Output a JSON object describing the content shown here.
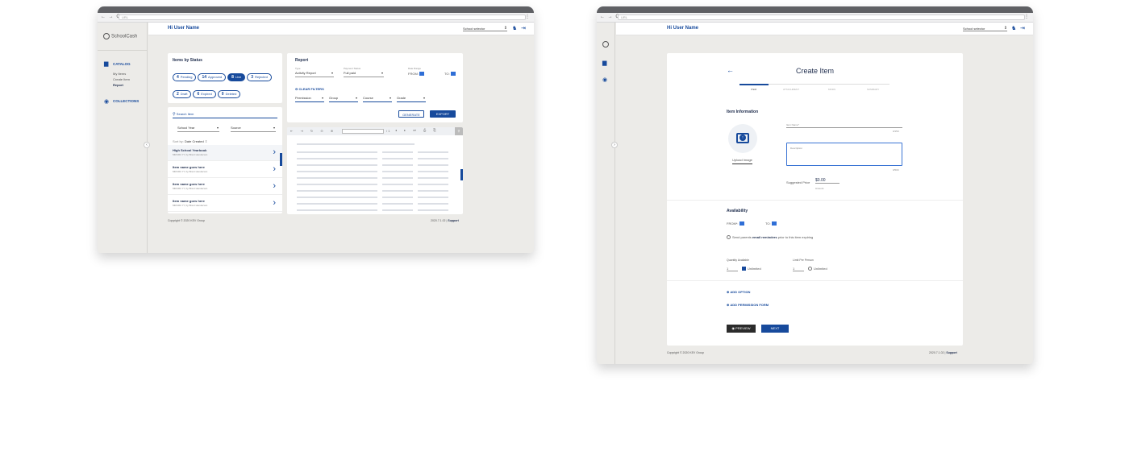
{
  "brand": {
    "name": "SchoolCash"
  },
  "browser": {
    "url": "URL"
  },
  "header": {
    "greeting": "Hi User Name",
    "school_select": "School selector"
  },
  "sidebar": {
    "catalog": "CATALOG",
    "sub": [
      "My Items",
      "Create Item",
      "Report"
    ],
    "collections": "COLLECTIONS"
  },
  "status": {
    "title": "Items by Status",
    "pills": [
      {
        "count": "4",
        "label": "Pending"
      },
      {
        "count": "14",
        "label": "Approved"
      },
      {
        "count": "8",
        "label": "Live"
      },
      {
        "count": "3",
        "label": "Rejected"
      },
      {
        "count": "2",
        "label": "Draft"
      },
      {
        "count": "6",
        "label": "Expired"
      },
      {
        "count": "0",
        "label": "Deleted"
      }
    ]
  },
  "search": {
    "placeholder": "Search Item",
    "school_year": "School Year",
    "source": "Source",
    "sort_by": "Sort by:",
    "sort_value": "Date Created"
  },
  "items": [
    {
      "name": "High School Yearbook",
      "meta": "MM-DD-YY, by Brent Henderson"
    },
    {
      "name": "Item name goes here",
      "meta": "MM-DD-YY, by Brent Henderson"
    },
    {
      "name": "Item name goes here",
      "meta": "MM-DD-YY, by Brent Henderson"
    },
    {
      "name": "Item name goes here",
      "meta": "MM-DD-YY, by Brent Henderson"
    }
  ],
  "report": {
    "title": "Report",
    "type_label": "Type",
    "type_value": "Activity Report",
    "payment_label": "Payment Status",
    "payment_value": "Full paid",
    "date_label": "Date Range",
    "from": "FROM:",
    "to": "TO:",
    "clear": "CLEAR FILTERS",
    "filters": [
      "Permission",
      "Group",
      "Course",
      "Grade"
    ],
    "generate": "GENERATE",
    "export": "EXPORT",
    "page_of": "/ 1"
  },
  "footer": {
    "copyright": "Copyright © 2020 KEV Group",
    "version": "2020.7.1.02",
    "support": "Support"
  },
  "create": {
    "title": "Create Item",
    "steps": [
      "ITEM",
      "ATTACHMENT",
      "MODS",
      "SUMMARY"
    ],
    "info_title": "Item Information",
    "name_label": "Item Name*",
    "name_count": "0/150",
    "desc_placeholder": "Description",
    "desc_count": "0/500",
    "upload": "Upload Image",
    "price_label": "Suggested Price",
    "price_value": "$0.00",
    "price_hint": "Amount",
    "availability": "Availability",
    "from": "FROM*:",
    "to": "TO:",
    "reminder_pre": "Send parents ",
    "reminder_bold": "email reminders",
    "reminder_post": " prior to this item expiring",
    "qty_label": "Quantity Available",
    "qty_value": "1",
    "limit_label": "Limit Per Person",
    "limit_value": "1",
    "unlimited": "Unlimited",
    "add_option": "ADD OPTION",
    "add_permission": "ADD PERMISSION FORM",
    "preview": "PREVIEW",
    "next": "NEXT"
  }
}
